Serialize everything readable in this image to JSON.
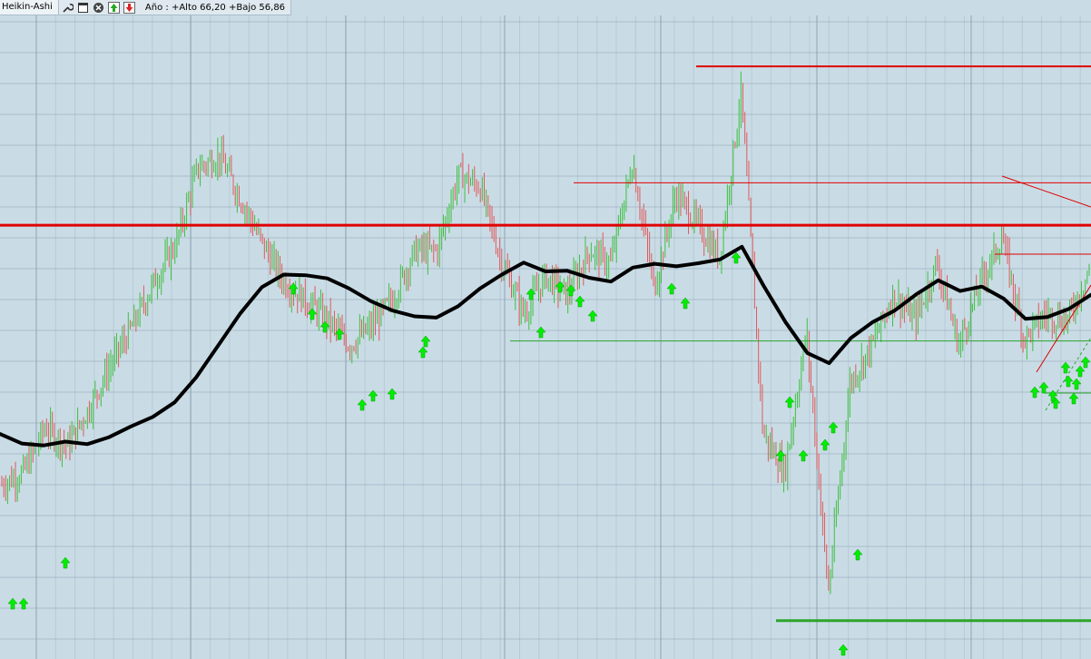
{
  "toolbar": {
    "indicator_name": "Heikin-Ashi",
    "summary": "Año : +Alto 66,20 +Bajo 56,86",
    "icons": [
      "wrench-icon",
      "window-icon",
      "close-icon",
      "move-up-icon",
      "move-down-icon"
    ]
  },
  "chart_data": {
    "type": "line",
    "title": "",
    "xlabel": "",
    "ylabel": "",
    "ylim": [
      56.86,
      66.2
    ],
    "grid": true,
    "colors": {
      "background": "#c9dce6",
      "grid": "#8ea3b1",
      "up_candle": "#3fbf3f",
      "down_candle": "#e05a5a",
      "moving_average": "#000000",
      "resistance": "#e00000",
      "support": "#2aa52a",
      "buy_arrow": "#00ee00"
    },
    "series": [
      {
        "kind": "moving-average",
        "values": [
          60.0,
          59.85,
          59.82,
          59.88,
          59.84,
          59.95,
          60.12,
          60.27,
          60.5,
          60.9,
          61.4,
          61.9,
          62.32,
          62.52,
          62.51,
          62.46,
          62.3,
          62.1,
          61.95,
          61.86,
          61.84,
          62.02,
          62.3,
          62.52,
          62.71,
          62.57,
          62.58,
          62.47,
          62.41,
          62.63,
          62.69,
          62.65,
          62.7,
          62.76,
          62.96,
          62.34,
          61.77,
          61.28,
          61.12,
          61.52,
          61.77,
          61.95,
          62.21,
          62.43,
          62.26,
          62.33,
          62.14,
          61.82,
          61.85,
          61.98,
          62.2
        ]
      },
      {
        "kind": "heikin-ashi-close",
        "values": [
          59.2,
          59.4,
          60.1,
          59.8,
          60.4,
          61.1,
          61.7,
          62.4,
          63.0,
          64.2,
          64.4,
          63.7,
          63.0,
          62.4,
          62.1,
          61.8,
          61.4,
          61.7,
          62.15,
          62.9,
          62.9,
          64.1,
          63.9,
          62.7,
          61.9,
          62.5,
          62.2,
          62.9,
          62.7,
          64.3,
          62.3,
          63.8,
          63.3,
          62.8,
          65.4,
          60.0,
          59.4,
          61.6,
          57.5,
          60.8,
          61.4,
          62.2,
          61.8,
          62.7,
          61.4,
          62.4,
          63.1,
          61.5,
          61.9,
          61.8,
          62.6
        ]
      }
    ],
    "annotations": {
      "horizontal_lines": [
        {
          "kind": "resistance",
          "value": 65.81
        },
        {
          "kind": "resistance",
          "value": 63.97
        },
        {
          "kind": "resistance",
          "value": 63.3
        },
        {
          "kind": "support",
          "value": 61.47
        },
        {
          "kind": "support",
          "value": 57.05
        }
      ],
      "buy_signals": 38
    }
  }
}
